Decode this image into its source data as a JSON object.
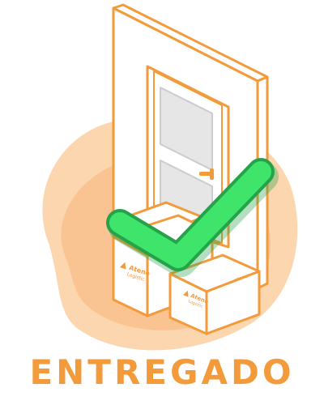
{
  "status": {
    "label": "ENTREGADO"
  },
  "boxes": {
    "brand_name": "Atene",
    "brand_sub": "Logistic",
    "tape_text": "atene"
  },
  "colors": {
    "accent": "#f39a3b",
    "blob_light": "#fbd1a6",
    "blob_mid": "#f7b679",
    "door_panel": "#e6e6e6",
    "check_fill": "#3ee56a",
    "check_dark": "#26a24a",
    "text": "#f39a3b"
  },
  "icons": {
    "success": "checkmark-icon",
    "door": "door-icon",
    "package": "package-icon"
  }
}
